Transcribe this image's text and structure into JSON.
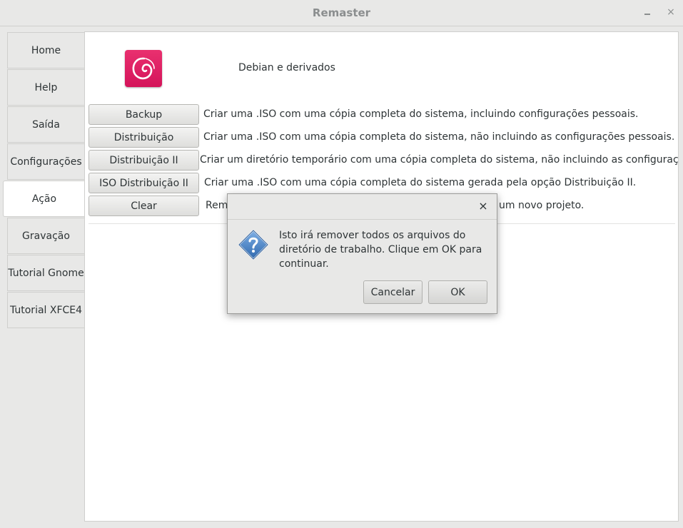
{
  "window": {
    "title": "Remaster",
    "minimize_glyph": "minimize-icon",
    "close_glyph": "×"
  },
  "tabs": [
    {
      "label": "Home",
      "active": false
    },
    {
      "label": "Help",
      "active": false
    },
    {
      "label": "Saída",
      "active": false
    },
    {
      "label": "Configurações",
      "active": false
    },
    {
      "label": "Ação",
      "active": true
    },
    {
      "label": "Gravação",
      "active": false
    },
    {
      "label": "Tutorial Gnome",
      "active": false
    },
    {
      "label": "Tutorial XFCE4",
      "active": false
    }
  ],
  "main": {
    "logo_icon": "debian-swirl-icon",
    "distro_label": "Debian e derivados",
    "actions": [
      {
        "label": "Backup",
        "description": "Criar uma .ISO com uma cópia completa do sistema, incluindo configurações pessoais."
      },
      {
        "label": "Distribuição",
        "description": "Criar uma .ISO com uma cópia completa do sistema, não incluindo as configurações pessoais."
      },
      {
        "label": "Distribuição II",
        "description": "Criar um diretório temporário com uma cópia completa do sistema, não incluindo as configurações pessoais."
      },
      {
        "label": "ISO Distribuição II",
        "description": "Criar uma .ISO com uma cópia completa do sistema gerada pela opção Distribuição II."
      },
      {
        "label": "Clear",
        "description": "Remo",
        "description_end": "um novo projeto."
      }
    ]
  },
  "dialog": {
    "close_glyph": "×",
    "icon": "question-icon",
    "message": "Isto irá remover todos os arquivos do diretório de trabalho. Clique em OK para continuar.",
    "cancel_label": "Cancelar",
    "ok_label": "OK"
  },
  "colors": {
    "accent": "#d70751",
    "window_bg": "#e8e8e7",
    "content_bg": "#ffffff",
    "icon_blue": "#4f86c6"
  }
}
